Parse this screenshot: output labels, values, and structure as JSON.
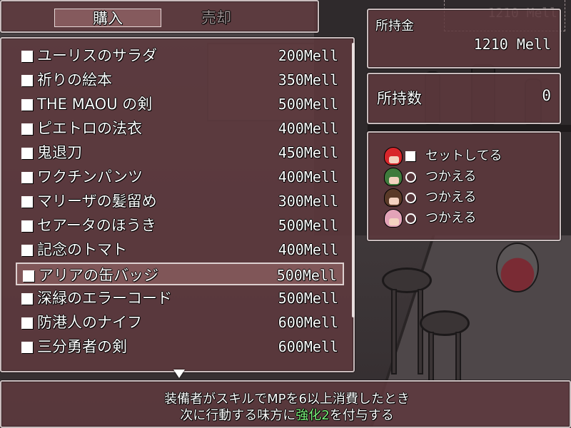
{
  "tabs": {
    "buy": "購入",
    "sell": "売却"
  },
  "money": {
    "label": "所持金",
    "value": "1210 Mell",
    "ghost_value": "1210 Mell"
  },
  "owned": {
    "label": "所持数",
    "value": "0"
  },
  "items": [
    {
      "name": "ユーリスのサラダ",
      "price": "200Mell"
    },
    {
      "name": "祈りの絵本",
      "price": "350Mell"
    },
    {
      "name": "THE MAOU の剣",
      "price": "500Mell"
    },
    {
      "name": "ピエトロの法衣",
      "price": "400Mell"
    },
    {
      "name": "鬼退刀",
      "price": "450Mell"
    },
    {
      "name": "ワクチンパンツ",
      "price": "400Mell"
    },
    {
      "name": "マリーザの髪留め",
      "price": "300Mell"
    },
    {
      "name": "セアータのほうき",
      "price": "500Mell"
    },
    {
      "name": "記念のトマト",
      "price": "400Mell"
    },
    {
      "name": "アリアの缶バッジ",
      "price": "500Mell"
    },
    {
      "name": "深緑のエラーコード",
      "price": "500Mell"
    },
    {
      "name": "防港人のナイフ",
      "price": "600Mell"
    },
    {
      "name": "三分勇者の剣",
      "price": "600Mell"
    }
  ],
  "selected_index": 9,
  "party": [
    {
      "mark": "square",
      "status": "セットしてる",
      "hair_color": "#d8262b"
    },
    {
      "mark": "circle",
      "status": "つかえる",
      "hair_color": "#3f7a3c"
    },
    {
      "mark": "circle",
      "status": "つかえる",
      "hair_color": "#5a3a28"
    },
    {
      "mark": "circle",
      "status": "つかえる",
      "hair_color": "#e3a3b8"
    }
  ],
  "description": {
    "line1": "装備者がスキルでMPを6以上消費したとき",
    "line2_before": "次に行動する味方に",
    "line2_highlight": "強化2",
    "line2_after": "を付与する"
  },
  "colors": {
    "highlight": "#7cf37c",
    "window": "#5f3a3e"
  }
}
